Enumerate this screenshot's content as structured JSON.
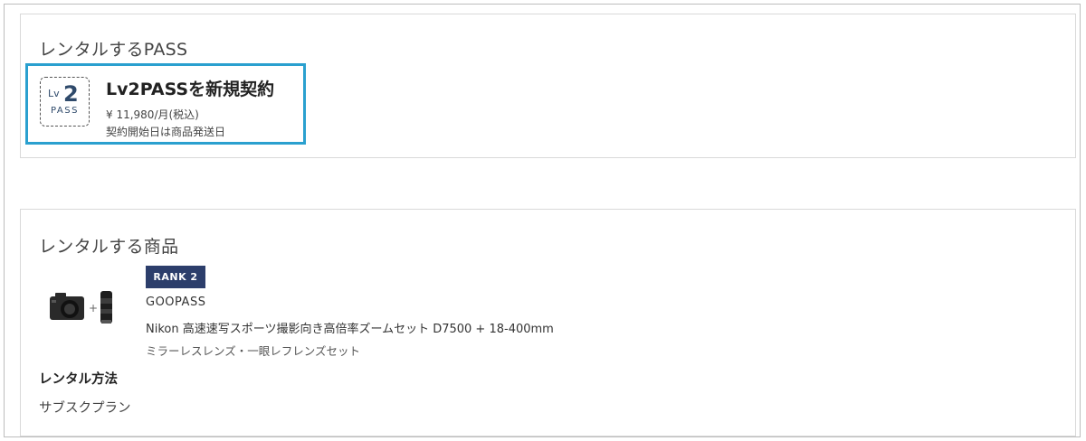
{
  "pass_section": {
    "title": "レンタルするPASS",
    "option": {
      "logo_prefix": "Lv",
      "logo_number": "2",
      "logo_word": "PASS",
      "name": "Lv2PASSを新規契約",
      "price": "¥ 11,980/月(税込)",
      "start_note": "契約開始日は商品発送日",
      "selected": true,
      "accent_color": "#2aa0cf"
    }
  },
  "product_section": {
    "title": "レンタルする商品",
    "image_icon": "camera-with-zoom-lens",
    "rank_badge": "RANK 2",
    "rank_badge_color": "#2c3e6b",
    "brand": "GOOPASS",
    "product_name": "Nikon 高速速写スポーツ撮影向き高倍率ズームセット D7500 + 18-400mm",
    "product_category": "ミラーレスレンズ・一眼レフレンズセット",
    "rental_method_label": "レンタル方法",
    "rental_method_value": "サブスクプラン"
  }
}
